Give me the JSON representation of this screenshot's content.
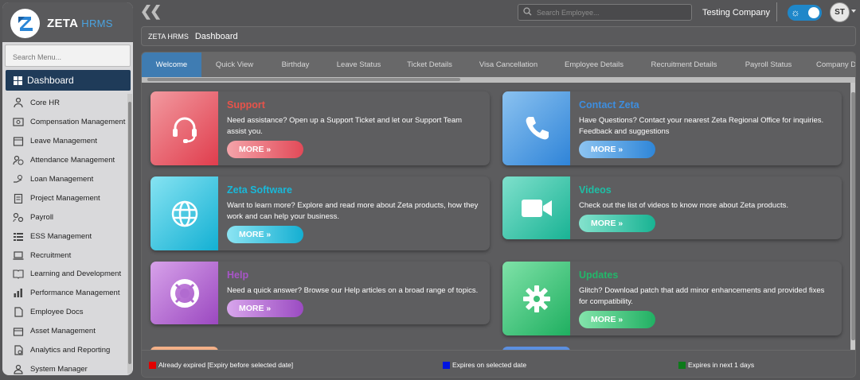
{
  "app": {
    "brand": "ZETA",
    "brand_sub": "HRMS"
  },
  "sidebar": {
    "search_placeholder": "Search Menu...",
    "dashboard_label": "Dashboard",
    "items": [
      {
        "label": "Core HR",
        "icon": "hierarchy-icon"
      },
      {
        "label": "Compensation Management",
        "icon": "money-icon"
      },
      {
        "label": "Leave Management",
        "icon": "calendar-icon"
      },
      {
        "label": "Attendance Management",
        "icon": "user-clock-icon"
      },
      {
        "label": "Loan Management",
        "icon": "loan-icon"
      },
      {
        "label": "Project Management",
        "icon": "clipboard-icon"
      },
      {
        "label": "Payroll",
        "icon": "payroll-icon"
      },
      {
        "label": "ESS Management",
        "icon": "list-icon"
      },
      {
        "label": "Recruitment",
        "icon": "laptop-icon"
      },
      {
        "label": "Learning and Development",
        "icon": "book-icon"
      },
      {
        "label": "Performance Management",
        "icon": "chart-icon"
      },
      {
        "label": "Employee Docs",
        "icon": "document-icon"
      },
      {
        "label": "Asset Management",
        "icon": "box-icon"
      },
      {
        "label": "Analytics and Reporting",
        "icon": "report-icon"
      },
      {
        "label": "System Manager",
        "icon": "admin-icon"
      }
    ]
  },
  "topbar": {
    "employee_search_placeholder": "Search Employee...",
    "company": "Testing Company",
    "avatar_initials": "ST"
  },
  "breadcrumb": {
    "root": "ZETA HRMS",
    "current": "Dashboard"
  },
  "tabs": [
    "Welcome",
    "Quick View",
    "Birthday",
    "Leave Status",
    "Ticket Details",
    "Visa Cancellation",
    "Employee Details",
    "Recruitment Details",
    "Payroll Status",
    "Company Documents"
  ],
  "active_tab": "Welcome",
  "cards": [
    {
      "title": "Support",
      "desc": "Need assistance? Open up a Support Ticket and let our Support Team assist you.",
      "button": "MORE",
      "icon": "headset-icon",
      "color": "#e8534a"
    },
    {
      "title": "Contact Zeta",
      "desc": "Have Questions? Contact your nearest Zeta Regional Office for inquiries. Feedback and suggestions",
      "button": "MORE",
      "icon": "phone-icon",
      "color": "#3d8ee0"
    },
    {
      "title": "Zeta Software",
      "desc": "Want to learn more? Explore and read more about Zeta products, how they work and can help your business.",
      "button": "MORE",
      "icon": "globe-icon",
      "color": "#19b8d9"
    },
    {
      "title": "Videos",
      "desc": "Check out the list of videos to know more about Zeta products.",
      "button": "MORE",
      "icon": "video-icon",
      "color": "#1ebfa5"
    },
    {
      "title": "Help",
      "desc": "Need a quick answer? Browse our Help articles on a broad range of topics.",
      "button": "MORE",
      "icon": "lifebuoy-icon",
      "color": "#a855c8"
    },
    {
      "title": "Updates",
      "desc": "Glitch? Download patch that add minor enhancements and provided fixes for compatibility.",
      "button": "MORE",
      "icon": "gear-icon",
      "color": "#22b86a"
    }
  ],
  "legend": [
    {
      "label": "Already expired [Expiry before selected date]",
      "color": "#e00000"
    },
    {
      "label": "Expires on selected date",
      "color": "#0014e0"
    },
    {
      "label": "Expires in next 1 days",
      "color": "#0d7a1a"
    }
  ]
}
